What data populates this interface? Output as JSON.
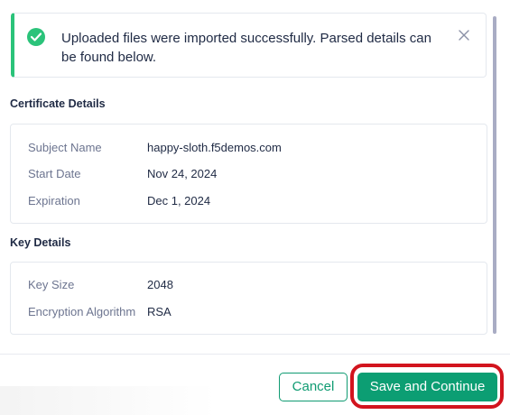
{
  "alert": {
    "message": "Uploaded files were imported successfully. Parsed details can be found below."
  },
  "certificate": {
    "title": "Certificate Details",
    "rows": [
      {
        "label": "Subject Name",
        "value": "happy-sloth.f5demos.com"
      },
      {
        "label": "Start Date",
        "value": "Nov 24, 2024"
      },
      {
        "label": "Expiration",
        "value": "Dec 1, 2024"
      }
    ]
  },
  "key": {
    "title": "Key Details",
    "rows": [
      {
        "label": "Key Size",
        "value": "2048"
      },
      {
        "label": "Encryption Algorithm",
        "value": "RSA"
      }
    ]
  },
  "footer": {
    "cancel_label": "Cancel",
    "save_label": "Save and Continue"
  },
  "colors": {
    "success": "#2bc37a",
    "primary": "#0c9e73",
    "highlight": "#d2141e"
  }
}
